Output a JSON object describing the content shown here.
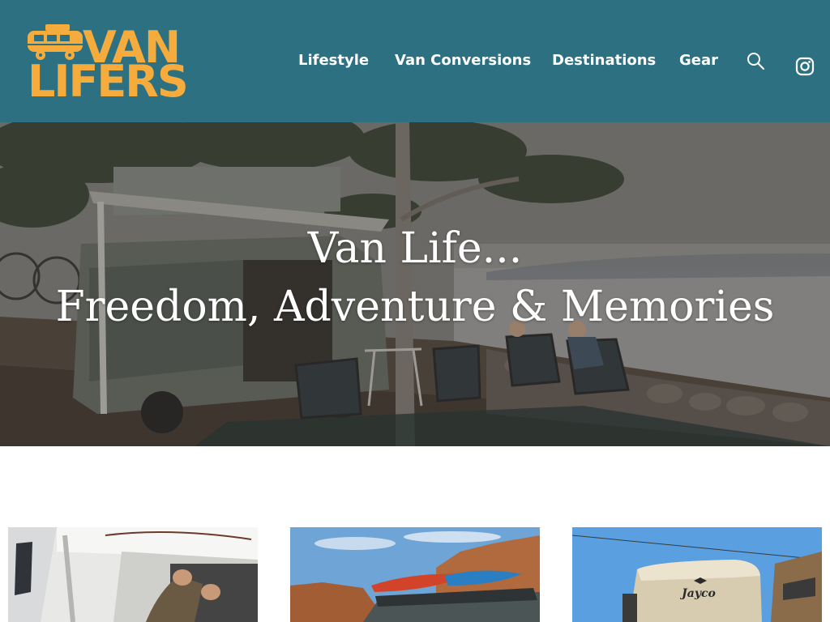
{
  "logo": {
    "line1": "VAN",
    "line2": "LIFERS",
    "color": "#f5ac3c"
  },
  "header": {
    "background": "#2c7081"
  },
  "nav": {
    "items": [
      {
        "label": "Lifestyle"
      },
      {
        "label": "Van Conversions"
      },
      {
        "label": "Destinations"
      },
      {
        "label": "Gear"
      }
    ],
    "search_icon": "search-icon",
    "social_icon": "instagram-icon"
  },
  "hero": {
    "line1": "Van Life...",
    "line2": "Freedom, Adventure & Memories"
  },
  "cards": [
    {
      "image": "van-interior-wiring-photo"
    },
    {
      "image": "van-with-kayaks-photo"
    },
    {
      "image": "jayco-trailer-photo",
      "visible_text": "Jayco"
    }
  ]
}
